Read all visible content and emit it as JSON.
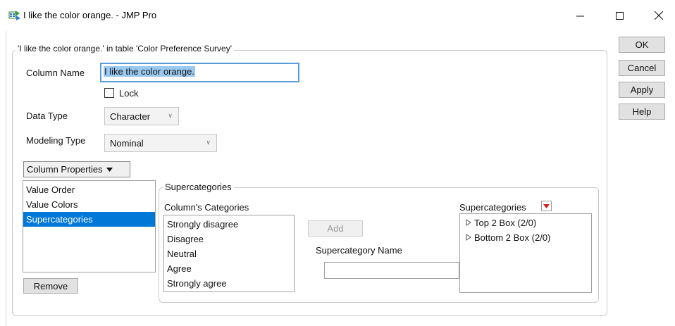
{
  "window": {
    "title": "I like the color orange. - JMP Pro",
    "minimize_glyph": "—",
    "maximize_glyph": "☐",
    "close_glyph": "✕"
  },
  "outer_group": {
    "legend": "'I like the color orange.' in table 'Color Preference Survey'"
  },
  "column_name": {
    "label": "Column Name",
    "value": "I like the color orange."
  },
  "lock": {
    "label": "Lock",
    "checked": false
  },
  "data_type": {
    "label": "Data Type",
    "value": "Character"
  },
  "modeling_type": {
    "label": "Modeling Type",
    "value": "Nominal"
  },
  "column_properties": {
    "button_label": "Column Properties",
    "items": [
      "Value Order",
      "Value Colors",
      "Supercategories"
    ],
    "selected_index": 2,
    "remove_label": "Remove"
  },
  "supercategories_panel": {
    "legend": "Supercategories",
    "categories_header": "Column's Categories",
    "categories": [
      "Strongly disagree",
      "Disagree",
      "Neutral",
      "Agree",
      "Strongly agree"
    ],
    "add_label": "Add",
    "name_label": "Supercategory Name",
    "name_value": "",
    "supercategories_header": "Supercategories",
    "supercategories": [
      "Top 2 Box (2/0)",
      "Bottom 2 Box (2/0)"
    ]
  },
  "actions": {
    "ok": "OK",
    "cancel": "Cancel",
    "apply": "Apply",
    "help": "Help"
  },
  "colors": {
    "selection": "#0078d7",
    "red_menu_icon": "#d21f1f",
    "text_highlight": "#99c9ef"
  },
  "icons": {
    "app": "jmp-app-icon",
    "dropdown": "chevron-down-icon",
    "red_menu": "red-triangle-menu-icon",
    "disclosure": "disclosure-triangle-icon"
  }
}
